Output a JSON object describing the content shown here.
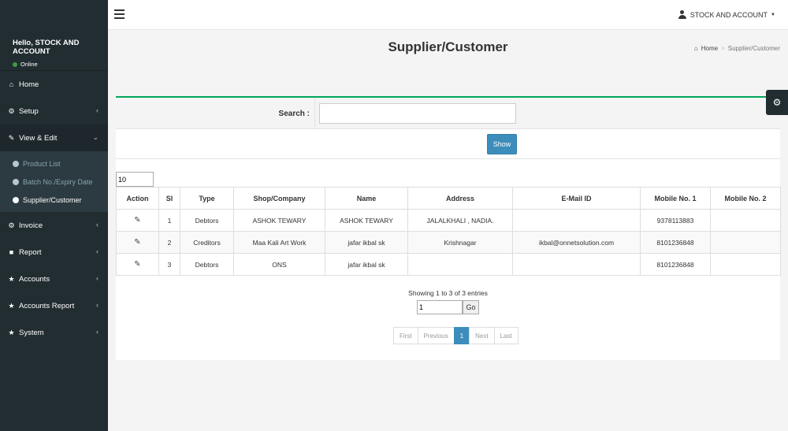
{
  "user": {
    "greeting": "Hello, STOCK AND ACCOUNT",
    "status": "Online"
  },
  "sidebar": {
    "items": [
      {
        "label": "Home",
        "icon": "home-icon"
      },
      {
        "label": "Setup",
        "icon": "cogs-icon"
      },
      {
        "label": "View & Edit",
        "icon": "edit-icon"
      },
      {
        "label": "Invoice",
        "icon": "cog-icon"
      },
      {
        "label": "Report",
        "icon": "book-icon"
      },
      {
        "label": "Accounts",
        "icon": "star-icon"
      },
      {
        "label": "Accounts Report",
        "icon": "star-icon"
      },
      {
        "label": "System",
        "icon": "star-icon"
      }
    ],
    "submenu": [
      {
        "label": "Product List"
      },
      {
        "label": "Batch No./Expiry Date"
      },
      {
        "label": "Supplier/Customer"
      }
    ]
  },
  "header": {
    "account_label": "STOCK AND ACCOUNT"
  },
  "page": {
    "title": "Supplier/Customer"
  },
  "breadcrumb": {
    "home": "Home",
    "current": "Supplier/Customer"
  },
  "search": {
    "label": "Search :",
    "value": "",
    "show_button": "Show"
  },
  "table": {
    "page_length": "10",
    "columns": [
      "Action",
      "Sl",
      "Type",
      "Shop/Company",
      "Name",
      "Address",
      "E-Mail ID",
      "Mobile No. 1",
      "Mobile No. 2"
    ],
    "rows": [
      {
        "sl": "1",
        "type": "Debtors",
        "shop": "ASHOK TEWARY",
        "name": "ASHOK TEWARY",
        "address": "JALALKHALI , NADIA.",
        "email": "",
        "mobile1": "9378113883",
        "mobile2": ""
      },
      {
        "sl": "2",
        "type": "Creditors",
        "shop": "Maa Kali Art Work",
        "name": "jafar ikbal sk",
        "address": "Krishnagar",
        "email": "ikbal@onnetsolution.com",
        "mobile1": "8101236848",
        "mobile2": ""
      },
      {
        "sl": "3",
        "type": "Debtors",
        "shop": "ONS",
        "name": "jafar ikbal sk",
        "address": "",
        "email": "",
        "mobile1": "8101236848",
        "mobile2": ""
      }
    ]
  },
  "pagination": {
    "info": "Showing 1 to 3 of 3 entries",
    "goto_value": "1",
    "go_button": "Go",
    "first": "First",
    "previous": "Previous",
    "current": "1",
    "next": "Next",
    "last": "Last"
  },
  "colors": {
    "sidebar_bg": "#222d32",
    "accent": "#3c8dbc",
    "box_border": "#00a65a"
  }
}
